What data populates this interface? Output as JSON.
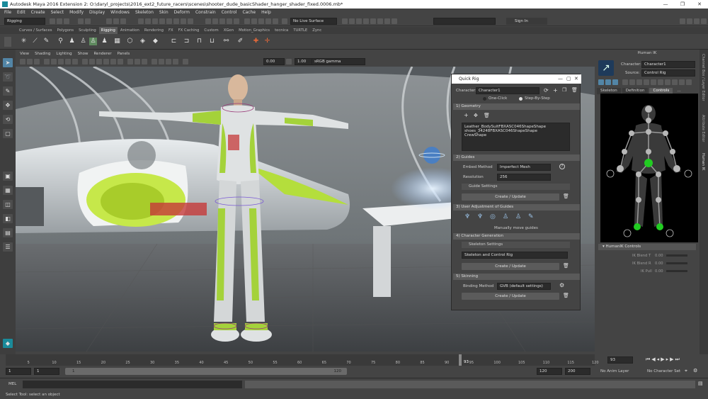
{
  "app": {
    "title": "Autodesk Maya 2016 Extension 2: O:\\daryl_projects\\2016_ext2_future_racers\\scenes\\shooter_dude_basicShader_hanger_shader_fixed.0006.mb*"
  },
  "menu": [
    "File",
    "Edit",
    "Create",
    "Select",
    "Modify",
    "Display",
    "Windows",
    "Skeleton",
    "Skin",
    "Deform",
    "Constrain",
    "Control",
    "Cache",
    "Help"
  ],
  "status_line": {
    "menuset": "Rigging",
    "live_surface": "No Live Surface",
    "sign_in": "Sign In"
  },
  "shelf_tabs": [
    "Curves / Surfaces",
    "Polygons",
    "Sculpting",
    "Rigging",
    "Animation",
    "Rendering",
    "FX",
    "FX Caching",
    "Custom",
    "XGen",
    "Motion_Graphics",
    "tecnica",
    "TURTLE",
    "Zync"
  ],
  "shelf_active": "Rigging",
  "viewport": {
    "menu": [
      "View",
      "Shading",
      "Lighting",
      "Show",
      "Renderer",
      "Panels"
    ],
    "exposure": "0.00",
    "gamma": "1.00",
    "color_space": "sRGB gamma"
  },
  "quick_rig": {
    "title": "Quick Rig",
    "character_label": "Character:",
    "character_value": "Character1",
    "mode_one_click": "One-Click",
    "mode_step": "Step-By-Step",
    "sections": {
      "geometry": "1) Geometry",
      "guides": "2) Guides",
      "user_adjust": "3) User Adjustment of Guides",
      "char_gen": "4) Character Generation",
      "skinning": "5) Skinning"
    },
    "geometry_list": [
      "Leather_BodySuitFBXASC046ShapeShape",
      "shoes_34248FBXASC046ShapeShape",
      "CrewShape"
    ],
    "embed_label": "Embed Method",
    "embed_value": "Imperfect Mesh",
    "resolution_label": "Resolution",
    "resolution_value": "256",
    "guide_settings": "Guide Settings",
    "create_update": "Create / Update",
    "manually_move": "Manually move guides",
    "skeleton_settings": "Skeleton Settings",
    "skeleton_rig": "Skeleton and Control Rig",
    "binding_label": "Binding Method",
    "binding_value": "GVB (default settings)"
  },
  "human_ik": {
    "title": "Human IK",
    "character_label": "Character:",
    "character_value": "Character1",
    "source_label": "Source:",
    "source_value": "Control Rig",
    "tabs": [
      "Skeleton",
      "Definition",
      "Controls"
    ],
    "active_tab": "Controls",
    "controls_header": "HumanIK Controls",
    "blends": [
      {
        "label": "IK Blend T",
        "value": "0.00"
      },
      {
        "label": "IK Blend R",
        "value": "0.00"
      },
      {
        "label": "IK Pull",
        "value": "0.00"
      }
    ]
  },
  "right_strip": [
    "Channel Box / Layer Editor",
    "Attribute Editor",
    "Human IK"
  ],
  "time_slider": {
    "ticks": [
      "5",
      "10",
      "15",
      "20",
      "25",
      "30",
      "35",
      "40",
      "45",
      "50",
      "55",
      "60",
      "65",
      "70",
      "75",
      "80",
      "85",
      "90",
      "95",
      "100",
      "105",
      "110",
      "115",
      "120"
    ],
    "current_frame": "93",
    "current_marker": "93"
  },
  "range_slider": {
    "start": "1",
    "start2": "1",
    "range_start_label": "1",
    "range_end_label": "120",
    "end": "120",
    "end2": "200",
    "anim_layer": "No Anim Layer",
    "char_set": "No Character Set"
  },
  "command_line": {
    "label": "MEL"
  },
  "help_line": "Select Tool: select an object",
  "colors": {
    "accent": "#5285a6",
    "suit_green": "#9acd32",
    "hik_green": "#22cc22"
  }
}
